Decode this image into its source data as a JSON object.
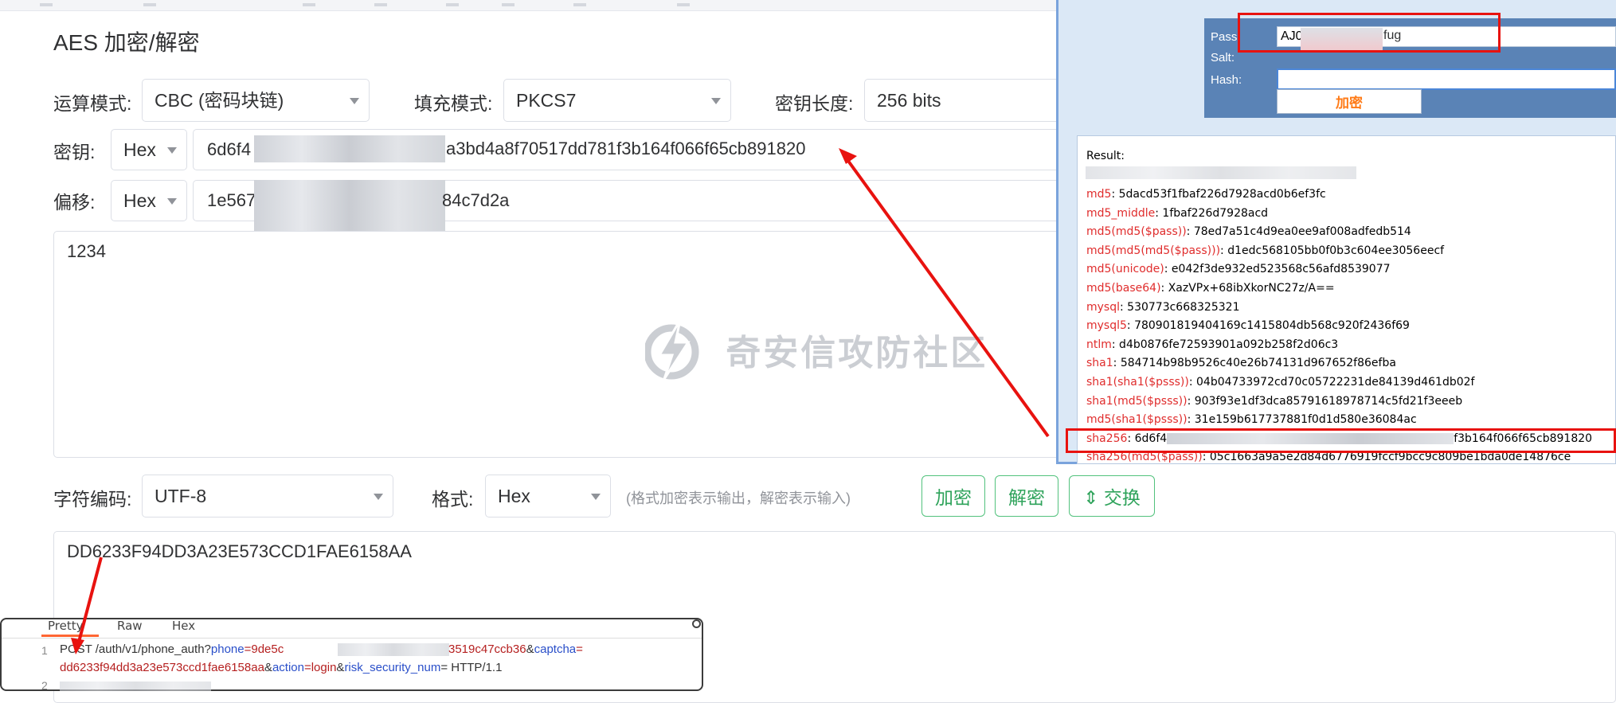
{
  "aes": {
    "title": "AES 加密/解密",
    "mode_label": "运算模式:",
    "mode_value": "CBC (密码块链)",
    "padding_label": "填充模式:",
    "padding_value": "PKCS7",
    "keylen_label": "密钥长度:",
    "keylen_value": "256 bits",
    "key_label": "密钥:",
    "key_format": "Hex",
    "key_value_start": "6d6f4",
    "key_value_end": "a3bd4a8f70517dd781f3b164f066f65cb891820",
    "iv_label": "偏移:",
    "iv_format": "Hex",
    "iv_value_start": "1e567",
    "iv_value_end": "84c7d2a",
    "input_text": "1234",
    "charset_label": "字符编码:",
    "charset_value": "UTF-8",
    "format_label": "格式:",
    "format_value": "Hex",
    "format_hint": "(格式加密表示输出，解密表示输入)",
    "encrypt_btn": "加密",
    "decrypt_btn": "解密",
    "swap_btn": "⇕ 交换",
    "output_text": "DD6233F94DD3A23E573CCD1FAE6158AA",
    "watermark": "奇安信攻防社区"
  },
  "hash_tool": {
    "pass_label": "Pass:",
    "pass_value_start": "AJ0",
    "pass_value_end": "fug",
    "salt_label": "Salt:",
    "hash_label": "Hash:",
    "encrypt_btn": "加密",
    "result_label": "Result:",
    "results": [
      {
        "k": "md5",
        "v": "5dacd53f1fbaf226d7928acd0b6ef3fc"
      },
      {
        "k": "md5_middle",
        "v": "1fbaf226d7928acd"
      },
      {
        "k": "md5(md5($pass))",
        "v": "78ed7a51c4d9ea0ee9af008adfedb514"
      },
      {
        "k": "md5(md5(md5($pass)))",
        "v": "d1edc568105bb0f0b3c604ee3056eecf"
      },
      {
        "k": "md5(unicode)",
        "v": "e042f3de932ed523568c56afd8539077"
      },
      {
        "k": "md5(base64)",
        "v": "XazVPx+68ibXkorNC27z/A=="
      },
      {
        "k": "mysql",
        "v": "530773c668325321"
      },
      {
        "k": "mysql5",
        "v": "780901819404169c1415804db568c920f2436f69"
      },
      {
        "k": "ntlm",
        "v": "d4b0876fe72593901a092b258f2d06c3"
      },
      {
        "k": "sha1",
        "v": "584714b98b9526c40e26b74131d967652f86efba"
      },
      {
        "k": "sha1(sha1($psss))",
        "v": "04b04733972cd70c05722231de84139d461db02f"
      },
      {
        "k": "sha1(md5($psss))",
        "v": "903f93e1df3dca85791618978714c5fd21f3eeeb"
      },
      {
        "k": "md5(sha1($psss))",
        "v": "31e159b617737881f0d1d580e36084ac"
      },
      {
        "k": "sha256",
        "v": "6d6f4",
        "v_end": "f3b164f066f65cb891820"
      },
      {
        "k": "sha256(md5($pass))",
        "v": "05c1663a9a5e2d84d6776919fccf9bcc9c809be1bda0de14876ce"
      }
    ]
  },
  "burp": {
    "tabs": [
      "Pretty",
      "Raw",
      "Hex"
    ],
    "line1_method": "POST",
    "line1_path": "/auth/v1/phone_auth?",
    "line1_p1": "phone",
    "line1_v1_start": "=9de5c",
    "line1_v1_end": "3519c47ccb36",
    "line1_amp1": "&",
    "line1_p2": "captcha",
    "line1_eq": "=",
    "line2_v2": "dd6233f94dd3a23e573ccd1fae6158aa",
    "line2_amp2": "&",
    "line2_p3": "action",
    "line2_v3": "=login",
    "line2_amp3": "&",
    "line2_p4": "risk_security_num",
    "line2_tail": "= HTTP/1.1",
    "line_numbers": [
      "1",
      "2"
    ]
  },
  "colors": {
    "accent_green": "#2fa35b",
    "highlight_red": "#e8120f",
    "hash_key_red": "#e02c2c",
    "tool_blue": "#5a83b6"
  }
}
